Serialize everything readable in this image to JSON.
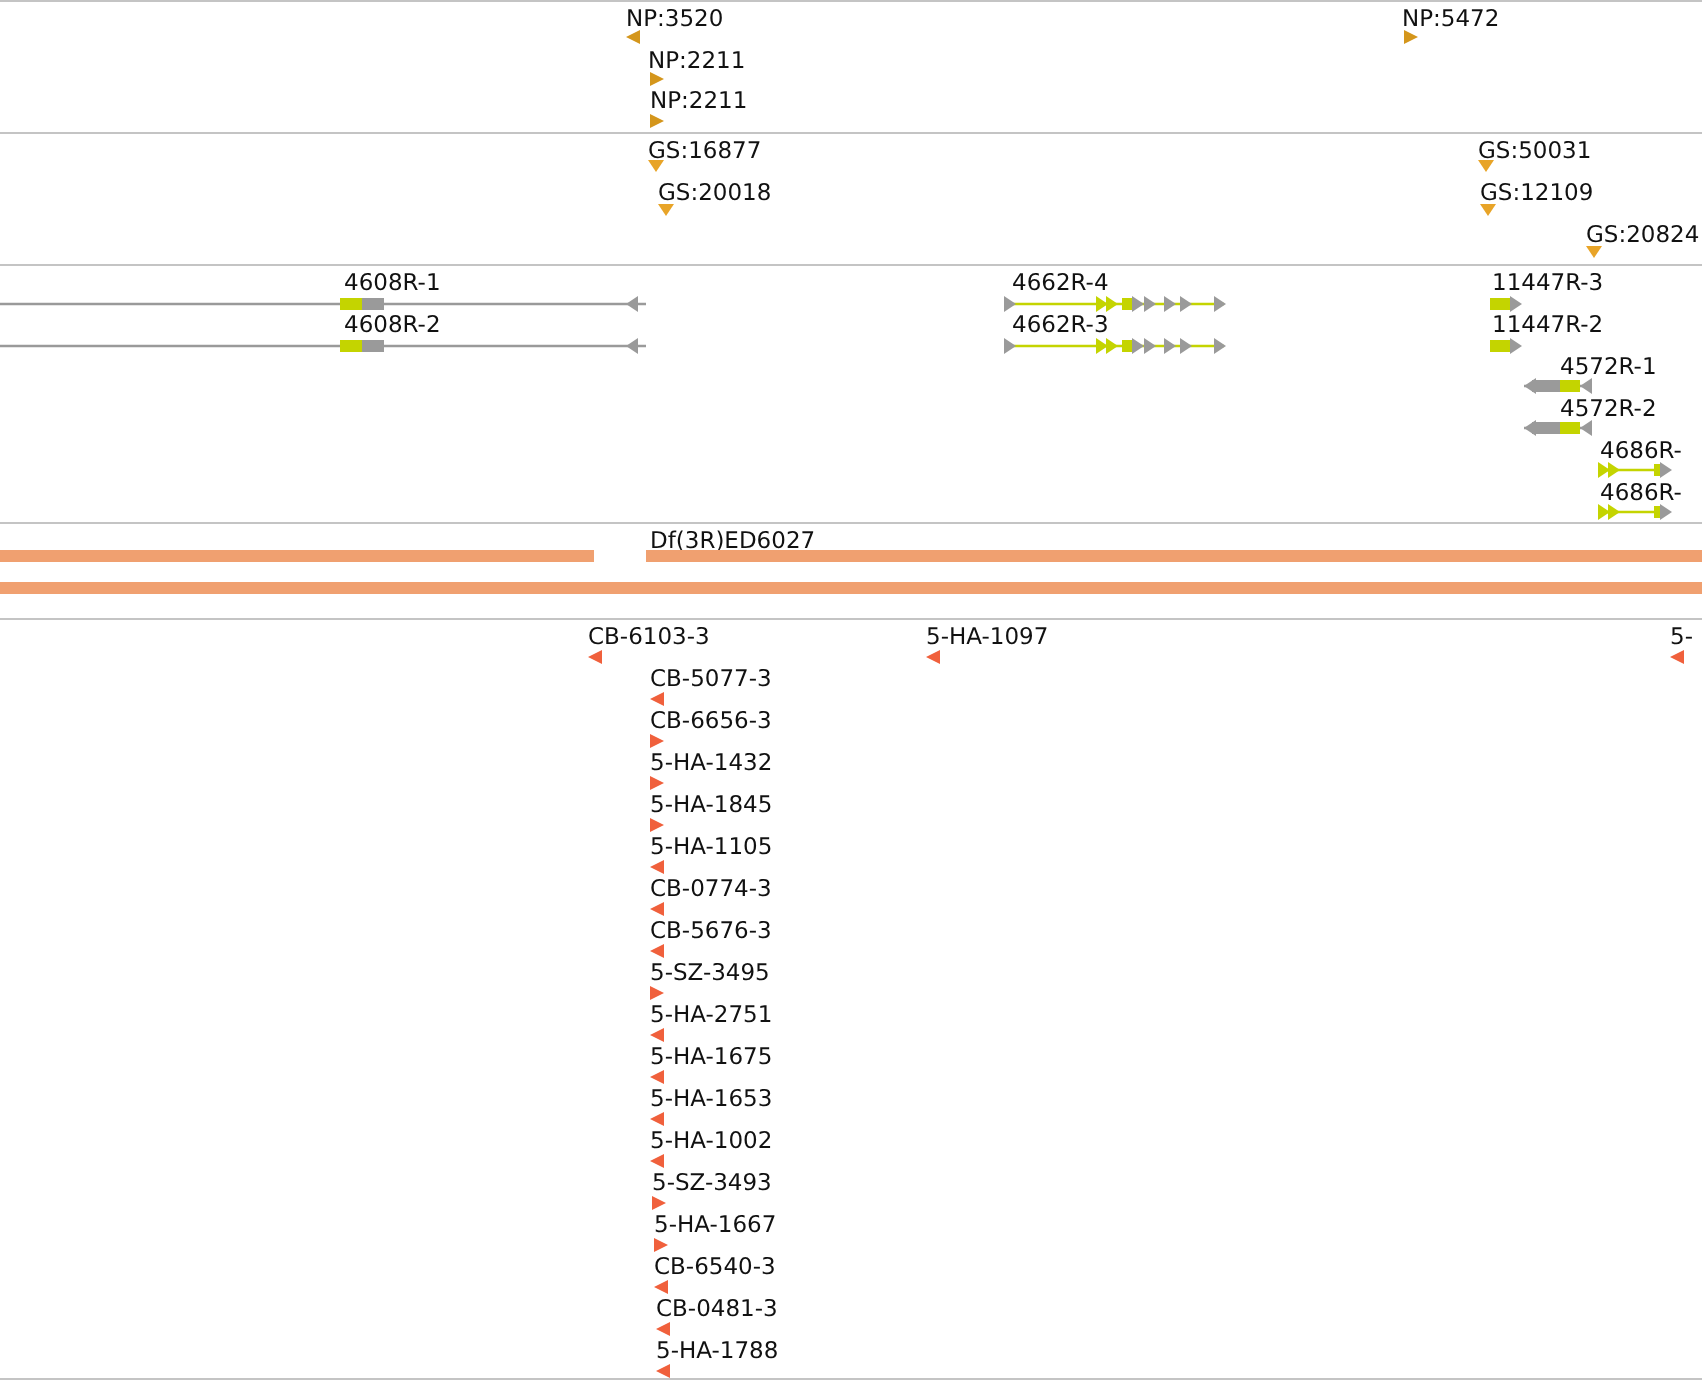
{
  "tracks": [
    {
      "kind": "markers",
      "color": "#d4961c",
      "features": [
        {
          "label": "NP:3520",
          "kind": "reverse"
        },
        {
          "label": "NP:2211",
          "kind": "forward"
        },
        {
          "label": "NP:2211",
          "kind": "forward"
        },
        {
          "label": "NP:5472",
          "kind": "forward"
        }
      ]
    },
    {
      "kind": "markers",
      "color": "#e8a428",
      "features": [
        {
          "label": "GS:16877",
          "kind": "unknown"
        },
        {
          "label": "GS:20018",
          "kind": "unknown"
        },
        {
          "label": "GS:50031",
          "kind": "unknown"
        },
        {
          "label": "GS:12109",
          "kind": "unknown"
        },
        {
          "label": "GS:20824",
          "kind": "unknown"
        }
      ]
    },
    {
      "kind": "transcripts",
      "features": [
        {
          "label": "4608R-1",
          "kind": "reverse"
        },
        {
          "label": "4608R-2",
          "kind": "reverse"
        },
        {
          "label": "4662R-4",
          "kind": "forward"
        },
        {
          "label": "4662R-3",
          "kind": "forward"
        },
        {
          "label": "11447R-3",
          "kind": "forward"
        },
        {
          "label": "11447R-2",
          "kind": "forward"
        },
        {
          "label": "4572R-1",
          "kind": "reverse"
        },
        {
          "label": "4572R-2",
          "kind": "reverse"
        },
        {
          "label": "4686R-",
          "kind": "forward"
        },
        {
          "label": "4686R-",
          "kind": "forward"
        }
      ]
    },
    {
      "kind": "deletions",
      "features": [
        {
          "label": "Df(3R)ED6027"
        }
      ]
    },
    {
      "kind": "markers",
      "color": "#f0603c",
      "features": [
        {
          "label": "CB-6103-3",
          "kind": "reverse"
        },
        {
          "label": "5-HA-1097",
          "kind": "reverse"
        },
        {
          "label": "5-",
          "kind": "reverse"
        },
        {
          "label": "CB-5077-3",
          "kind": "reverse"
        },
        {
          "label": "CB-6656-3",
          "kind": "forward"
        },
        {
          "label": "5-HA-1432",
          "kind": "forward"
        },
        {
          "label": "5-HA-1845",
          "kind": "forward"
        },
        {
          "label": "5-HA-1105",
          "kind": "reverse"
        },
        {
          "label": "CB-0774-3",
          "kind": "reverse"
        },
        {
          "label": "CB-5676-3",
          "kind": "reverse"
        },
        {
          "label": "5-SZ-3495",
          "kind": "forward"
        },
        {
          "label": "5-HA-2751",
          "kind": "reverse"
        },
        {
          "label": "5-HA-1675",
          "kind": "reverse"
        },
        {
          "label": "5-HA-1653",
          "kind": "reverse"
        },
        {
          "label": "5-HA-1002",
          "kind": "reverse"
        },
        {
          "label": "5-SZ-3493",
          "kind": "forward"
        },
        {
          "label": "5-HA-1667",
          "kind": "forward"
        },
        {
          "label": "CB-6540-3",
          "kind": "reverse"
        },
        {
          "label": "CB-0481-3",
          "kind": "reverse"
        },
        {
          "label": "5-HA-1788",
          "kind": "reverse"
        }
      ]
    }
  ]
}
